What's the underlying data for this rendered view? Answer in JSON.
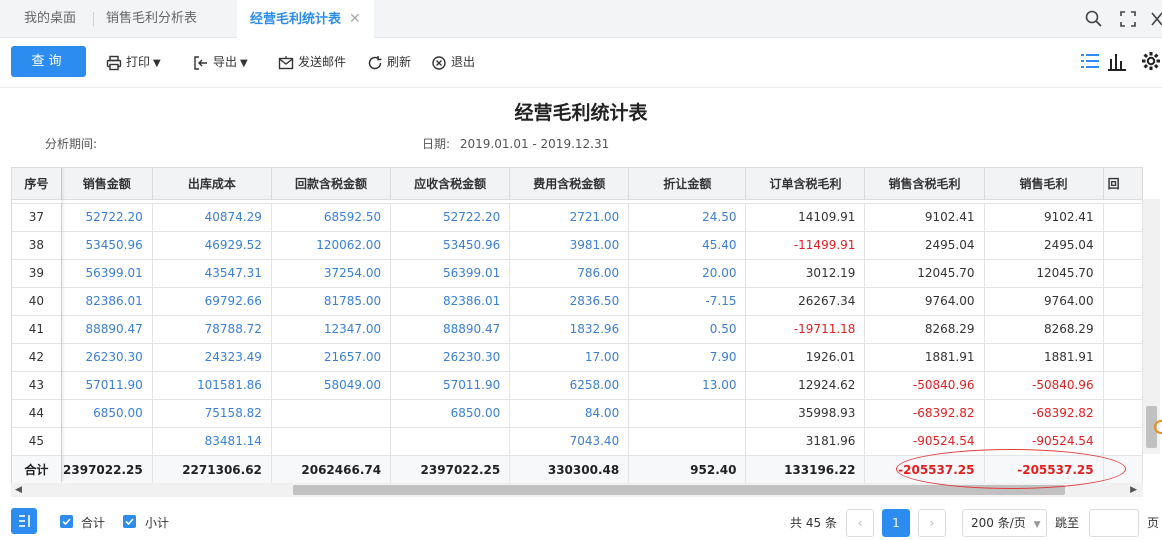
{
  "tabs": [
    {
      "label": "我的桌面"
    },
    {
      "label": "销售毛利分析表"
    },
    {
      "label": "经营毛利统计表",
      "close": "✕"
    }
  ],
  "toolbar": {
    "query": "查询",
    "print": "打印",
    "export": "导出",
    "email": "发送邮件",
    "refresh": "刷新",
    "exit": "退出"
  },
  "report": {
    "title": "经营毛利统计表",
    "period_label": "分析期间:",
    "date_label": "日期:",
    "date_value": "2019.01.01 - 2019.12.31"
  },
  "columns": [
    "序号",
    "销售金额",
    "出库成本",
    "回款含税金额",
    "应收含税金额",
    "费用含税金额",
    "折让金额",
    "订单含税毛利",
    "销售含税毛利",
    "销售毛利",
    "回"
  ],
  "rows": [
    {
      "no": "37",
      "cells": [
        "52722.20",
        "40874.29",
        "68592.50",
        "52722.20",
        "2721.00",
        "24.50",
        "14109.91",
        "9102.41",
        "9102.41"
      ]
    },
    {
      "no": "38",
      "cells": [
        "53450.96",
        "46929.52",
        "120062.00",
        "53450.96",
        "3981.00",
        "45.40",
        "-11499.91",
        "2495.04",
        "2495.04"
      ]
    },
    {
      "no": "39",
      "cells": [
        "56399.01",
        "43547.31",
        "37254.00",
        "56399.01",
        "786.00",
        "20.00",
        "3012.19",
        "12045.70",
        "12045.70"
      ]
    },
    {
      "no": "40",
      "cells": [
        "82386.01",
        "69792.66",
        "81785.00",
        "82386.01",
        "2836.50",
        "-7.15",
        "26267.34",
        "9764.00",
        "9764.00"
      ]
    },
    {
      "no": "41",
      "cells": [
        "88890.47",
        "78788.72",
        "12347.00",
        "88890.47",
        "1832.96",
        "0.50",
        "-19711.18",
        "8268.29",
        "8268.29"
      ]
    },
    {
      "no": "42",
      "cells": [
        "26230.30",
        "24323.49",
        "21657.00",
        "26230.30",
        "17.00",
        "7.90",
        "1926.01",
        "1881.91",
        "1881.91"
      ]
    },
    {
      "no": "43",
      "cells": [
        "57011.90",
        "101581.86",
        "58049.00",
        "57011.90",
        "6258.00",
        "13.00",
        "12924.62",
        "-50840.96",
        "-50840.96"
      ]
    },
    {
      "no": "44",
      "cells": [
        "6850.00",
        "75158.82",
        "",
        "6850.00",
        "84.00",
        "",
        "35998.93",
        "-68392.82",
        "-68392.82"
      ]
    },
    {
      "no": "45",
      "cells": [
        "",
        "83481.14",
        "",
        "",
        "7043.40",
        "",
        "3181.96",
        "-90524.54",
        "-90524.54"
      ]
    }
  ],
  "total": {
    "label": "合计",
    "cells": [
      "2397022.25",
      "2271306.62",
      "2062466.74",
      "2397022.25",
      "330300.48",
      "952.40",
      "133196.22",
      "-205537.25",
      "-205537.25"
    ]
  },
  "footer": {
    "sum_label": "合计",
    "subtotal_label": "小计",
    "count_text": "共 45 条",
    "prev": "‹",
    "page": "1",
    "next": "›",
    "page_size": "200 条/页",
    "jump_label": "跳至",
    "page_suffix": "页"
  },
  "colors": {
    "accent": "#2d8cf0",
    "link": "#3a7fd5",
    "negative": "#e02020"
  }
}
